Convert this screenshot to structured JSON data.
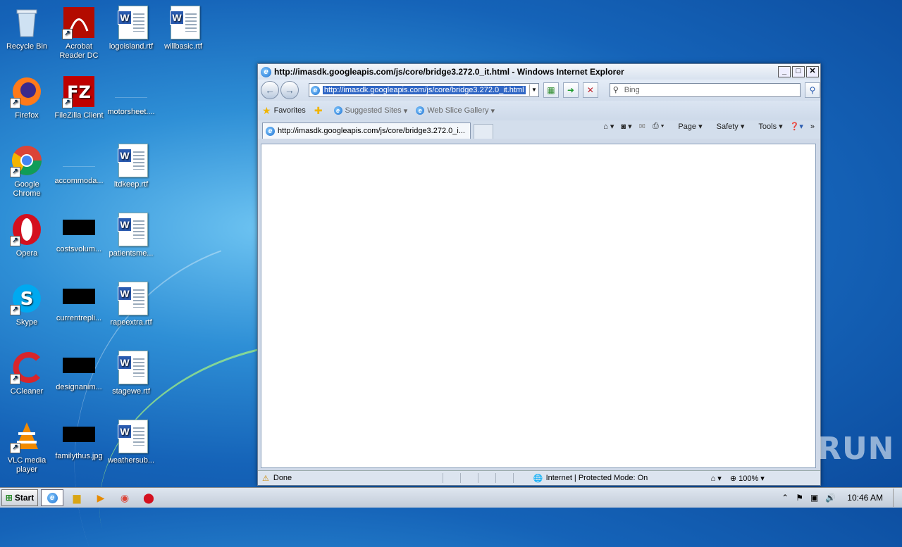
{
  "desktop": {
    "icons": [
      {
        "label": "Recycle Bin"
      },
      {
        "label": "Acrobat Reader DC"
      },
      {
        "label": "logoisland.rtf"
      },
      {
        "label": "willbasic.rtf"
      },
      {
        "label": "Firefox"
      },
      {
        "label": "FileZilla Client"
      },
      {
        "label": "motorsheet...."
      },
      {
        "label": "Google Chrome"
      },
      {
        "label": "accommoda..."
      },
      {
        "label": "ltdkeep.rtf"
      },
      {
        "label": "Opera"
      },
      {
        "label": "costsvolum..."
      },
      {
        "label": "patientsme..."
      },
      {
        "label": "Skype"
      },
      {
        "label": "currentrepli..."
      },
      {
        "label": "rapeextra.rtf"
      },
      {
        "label": "CCleaner"
      },
      {
        "label": "designanim..."
      },
      {
        "label": "stagewe.rtf"
      },
      {
        "label": "VLC media player"
      },
      {
        "label": "familythus.jpg"
      },
      {
        "label": "weathersub..."
      }
    ]
  },
  "ie": {
    "title": "http://imasdk.googleapis.com/js/core/bridge3.272.0_it.html - Windows Internet Explorer",
    "address": "http://imasdk.googleapis.com/js/core/bridge3.272.0_it.html",
    "search_placeholder": "Bing",
    "favorites": "Favorites",
    "suggested_sites": "Suggested Sites",
    "web_slice": "Web Slice Gallery",
    "tab_title": "http://imasdk.googleapis.com/js/core/bridge3.272.0_i...",
    "page_menu": "Page",
    "safety_menu": "Safety",
    "tools_menu": "Tools",
    "status_text": "Done",
    "zone_text": "Internet | Protected Mode: On",
    "zoom": "100%"
  },
  "taskbar": {
    "start": "Start",
    "time": "10:46 AM"
  },
  "watermark": "ANY RUN"
}
